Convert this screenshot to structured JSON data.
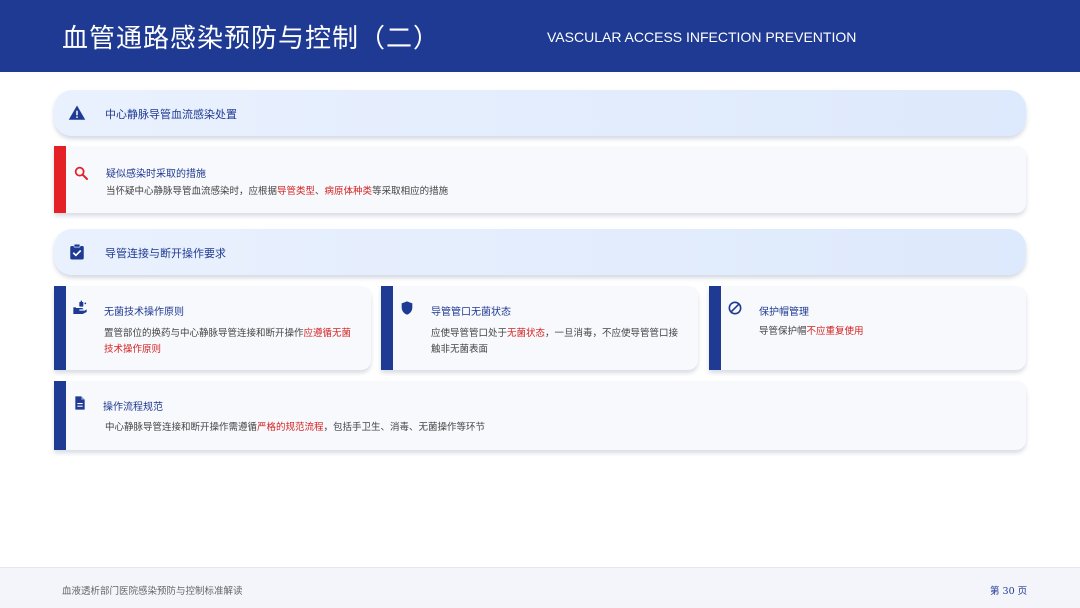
{
  "header": {
    "title": "血管通路感染预防与控制（二）",
    "subtitle": "VASCULAR ACCESS INFECTION PREVENTION"
  },
  "section1": {
    "label": "中心静脉导管血流感染处置",
    "icon": "warning-icon"
  },
  "suspected": {
    "title": "疑似感染时采取的措施",
    "icon": "search-icon",
    "body_pre": "当怀疑中心静脉导管血流感染时，应根据",
    "hl1": "导管类型",
    "sep": "、",
    "hl2": "病原体种类",
    "body_post": "等采取相应的措施",
    "accent": "#e32127"
  },
  "section2": {
    "label": "导管连接与断开操作要求",
    "icon": "clipboard-check-icon"
  },
  "cards": [
    {
      "title": "无菌技术操作原则",
      "icon": "hand-sanitize-icon",
      "body_pre": "置管部位的换药与中心静脉导管连接和断开操作",
      "hl": "应遵循无菌技术操作原则",
      "body_post": ""
    },
    {
      "title": "导管管口无菌状态",
      "icon": "shield-icon",
      "body_pre": "应使导管管口处于",
      "hl": "无菌状态",
      "body_post": "，一旦消毒，不应使导管管口接触非无菌表面"
    },
    {
      "title": "保护帽管理",
      "icon": "no-entry-icon",
      "body_pre": "导管保护帽",
      "hl": "不应重复使用",
      "body_post": ""
    }
  ],
  "process": {
    "title": "操作流程规范",
    "icon": "document-icon",
    "body_pre": "中心静脉导管连接和断开操作需遵循",
    "hl": "严格的规范流程",
    "body_post": "，包括手卫生、消毒、无菌操作等环节"
  },
  "footer": {
    "left": "血液透析部门医院感染预防与控制标准解读",
    "right": "第 30 页"
  },
  "colors": {
    "primary": "#1f3a93",
    "highlight": "#d42222",
    "accent_red": "#e32127"
  }
}
